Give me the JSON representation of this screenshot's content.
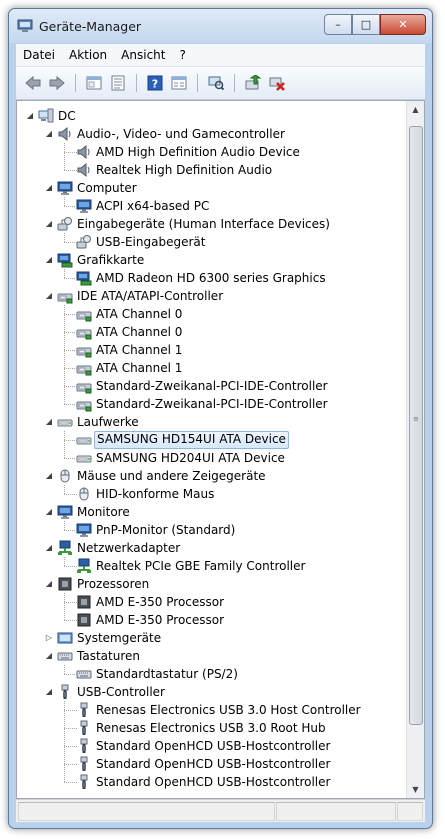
{
  "window": {
    "title": "Geräte-Manager",
    "buttons": {
      "minimize": "–",
      "maximize": "□",
      "close": "✕"
    }
  },
  "menu": [
    "Datei",
    "Aktion",
    "Ansicht",
    "?"
  ],
  "toolbar": [
    "back-icon",
    "forward-icon",
    "sep",
    "properties-icon",
    "details-view-icon",
    "sep",
    "help-icon",
    "show-hidden-icon",
    "sep",
    "scan-hardware-icon",
    "sep",
    "update-driver-icon",
    "uninstall-icon"
  ],
  "tree": [
    {
      "label": "DC",
      "level": 0,
      "expander": "open",
      "icon": "computer-icon"
    },
    {
      "label": "Audio-, Video- und Gamecontroller",
      "level": 1,
      "expander": "open",
      "icon": "speaker-icon"
    },
    {
      "label": "AMD High Definition Audio Device",
      "level": 2,
      "icon": "speaker-icon"
    },
    {
      "label": "Realtek High Definition Audio",
      "level": 2,
      "icon": "speaker-icon"
    },
    {
      "label": "Computer",
      "level": 1,
      "expander": "open",
      "icon": "monitor-icon"
    },
    {
      "label": "ACPI x64-based PC",
      "level": 2,
      "icon": "monitor-icon"
    },
    {
      "label": "Eingabegeräte (Human Interface Devices)",
      "level": 1,
      "expander": "open",
      "icon": "hid-icon"
    },
    {
      "label": "USB-Eingabegerät",
      "level": 2,
      "icon": "hid-icon"
    },
    {
      "label": "Grafikkarte",
      "level": 1,
      "expander": "open",
      "icon": "display-adapter-icon"
    },
    {
      "label": "AMD Radeon HD 6300 series Graphics",
      "level": 2,
      "icon": "display-adapter-icon"
    },
    {
      "label": "IDE ATA/ATAPI-Controller",
      "level": 1,
      "expander": "open",
      "icon": "ide-controller-icon"
    },
    {
      "label": "ATA Channel 0",
      "level": 2,
      "icon": "ide-controller-icon"
    },
    {
      "label": "ATA Channel 0",
      "level": 2,
      "icon": "ide-controller-icon"
    },
    {
      "label": "ATA Channel 1",
      "level": 2,
      "icon": "ide-controller-icon"
    },
    {
      "label": "ATA Channel 1",
      "level": 2,
      "icon": "ide-controller-icon"
    },
    {
      "label": "Standard-Zweikanal-PCI-IDE-Controller",
      "level": 2,
      "icon": "ide-controller-icon"
    },
    {
      "label": "Standard-Zweikanal-PCI-IDE-Controller",
      "level": 2,
      "icon": "ide-controller-icon"
    },
    {
      "label": "Laufwerke",
      "level": 1,
      "expander": "open",
      "icon": "disk-drive-icon"
    },
    {
      "label": "SAMSUNG HD154UI ATA Device",
      "level": 2,
      "icon": "disk-drive-icon",
      "selected": true
    },
    {
      "label": "SAMSUNG HD204UI ATA Device",
      "level": 2,
      "icon": "disk-drive-icon"
    },
    {
      "label": "Mäuse und andere Zeigegeräte",
      "level": 1,
      "expander": "open",
      "icon": "mouse-icon"
    },
    {
      "label": "HID-konforme Maus",
      "level": 2,
      "icon": "mouse-icon"
    },
    {
      "label": "Monitore",
      "level": 1,
      "expander": "open",
      "icon": "monitor-icon"
    },
    {
      "label": "PnP-Monitor (Standard)",
      "level": 2,
      "icon": "monitor-icon"
    },
    {
      "label": "Netzwerkadapter",
      "level": 1,
      "expander": "open",
      "icon": "network-adapter-icon"
    },
    {
      "label": "Realtek PCIe GBE Family Controller",
      "level": 2,
      "icon": "network-adapter-icon"
    },
    {
      "label": "Prozessoren",
      "level": 1,
      "expander": "open",
      "icon": "processor-icon"
    },
    {
      "label": "AMD E-350 Processor",
      "level": 2,
      "icon": "processor-icon"
    },
    {
      "label": "AMD E-350 Processor",
      "level": 2,
      "icon": "processor-icon"
    },
    {
      "label": "Systemgeräte",
      "level": 1,
      "expander": "closed",
      "icon": "system-device-icon"
    },
    {
      "label": "Tastaturen",
      "level": 1,
      "expander": "open",
      "icon": "keyboard-icon"
    },
    {
      "label": "Standardtastatur (PS/2)",
      "level": 2,
      "icon": "keyboard-icon"
    },
    {
      "label": "USB-Controller",
      "level": 1,
      "expander": "open",
      "icon": "usb-icon"
    },
    {
      "label": "Renesas Electronics USB 3.0 Host Controller",
      "level": 2,
      "icon": "usb-icon"
    },
    {
      "label": "Renesas Electronics USB 3.0 Root Hub",
      "level": 2,
      "icon": "usb-icon"
    },
    {
      "label": "Standard OpenHCD USB-Hostcontroller",
      "level": 2,
      "icon": "usb-icon"
    },
    {
      "label": "Standard OpenHCD USB-Hostcontroller",
      "level": 2,
      "icon": "usb-icon"
    },
    {
      "label": "Standard OpenHCD USB-Hostcontroller",
      "level": 2,
      "icon": "usb-icon"
    }
  ]
}
